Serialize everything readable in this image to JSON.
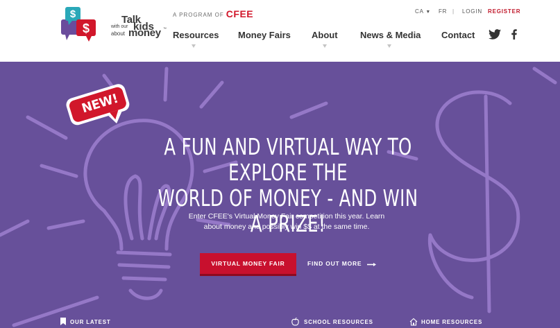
{
  "logo": {
    "talk": "Talk",
    "with_our": "with our",
    "kids": "kids",
    "about": "about",
    "money": "money",
    "tm": "™",
    "dollar_sign": "$"
  },
  "program": {
    "prefix": "A PROGRAM OF",
    "brand": "CFEE"
  },
  "utility_nav": {
    "region": "CA",
    "region_caret": "▼",
    "language": "FR",
    "separator": "|",
    "login": "LOGIN",
    "register": "REGISTER"
  },
  "nav": {
    "resources": "Resources",
    "money_fairs": "Money Fairs",
    "about": "About",
    "news_media": "News & Media",
    "contact": "Contact"
  },
  "social": {
    "twitter_icon": "twitter-icon",
    "facebook_icon": "facebook-icon"
  },
  "hero": {
    "badge": "NEW!",
    "headline_line1": "A FUN AND VIRTUAL WAY TO EXPLORE THE",
    "headline_line2": "WORLD OF MONEY - AND WIN A PRIZE!",
    "sub_line1": "Enter CFEE's Virtual Money Fair competition this year. Learn",
    "sub_line2": "about money and possibly win $$ at the same time.",
    "primary_button": "VIRTUAL MONEY FAIR",
    "secondary_link": "FIND OUT MORE"
  },
  "bottom_bar": {
    "our_latest": "OUR LATEST",
    "school_resources": "SCHOOL RESOURCES",
    "home_resources": "HOME RESOURCES"
  },
  "colors": {
    "brand_red": "#c8102e",
    "hero_purple": "#67509a",
    "nav_text": "#333333",
    "logo_teal": "#2aa8b8",
    "logo_purple": "#6a4c9c"
  }
}
